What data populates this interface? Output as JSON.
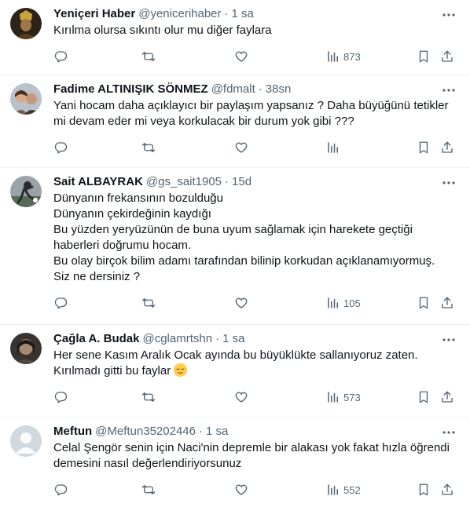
{
  "tweets": [
    {
      "name": "Yeniçeri Haber",
      "handle": "@yenicerihaber",
      "time": "1 sa",
      "text": "Kırılma olursa sıkıntı olur mu diğer faylara",
      "views": "873",
      "avatar_colors": [
        "#2c2418",
        "#c9a43a"
      ]
    },
    {
      "name": "Fadime ALTINIŞIK SÖNMEZ",
      "handle": "@fdmalt",
      "time": "38sn",
      "text": "Yani hocam daha açıklayıcı bir paylaşım yapsanız ? Daha büyüğünü tetikler\nmi devam eder mi veya korkulacak bir durum yok gibi ???",
      "views": "",
      "avatar_colors": [
        "#b9c2cc",
        "#7a5a48"
      ]
    },
    {
      "name": "Sait ALBAYRAK",
      "handle": "@gs_sait1905",
      "time": "15d",
      "text": "Dünyanın frekansının bozulduğu\nDünyanın çekirdeğinin kaydığı\nBu yüzden yeryüzünün de buna uyum sağlamak için harekete geçtiği\nhaberleri doğrumu hocam.\nBu olay birçok bilim adamı tarafından bilinip korkudan açıklanamıyormuş.\nSiz ne dersiniz ?",
      "views": "105",
      "avatar_colors": [
        "#9aa3a8",
        "#2a2d30"
      ]
    },
    {
      "name": "Çağla A. Budak",
      "handle": "@cglamrtshn",
      "time": "1 sa",
      "text": "Her sene Kasım Aralık Ocak ayında bu büyüklükte sallanıyoruz zaten.\nKırılmadı gitti bu faylar",
      "emoji": "relieved-face",
      "views": "573",
      "avatar_colors": [
        "#3a3430",
        "#a88a70"
      ]
    },
    {
      "name": "Meftun",
      "handle": "@Meftun35202446",
      "time": "1 sa",
      "text": "Celal Şengör senin için Naci'nin depremle bir alakası yok fakat hızla öğrendi\ndemesini nasıl değerlendiriyorsunuz",
      "views": "552",
      "avatar_colors": [
        "#cfd9de",
        "#ffffff"
      ]
    }
  ],
  "colors": {
    "text": "#0f1419",
    "muted": "#536471",
    "border": "#eff3f4"
  },
  "icons": [
    "reply-icon",
    "retweet-icon",
    "like-icon",
    "views-icon",
    "bookmark-icon",
    "share-icon",
    "more-icon"
  ]
}
